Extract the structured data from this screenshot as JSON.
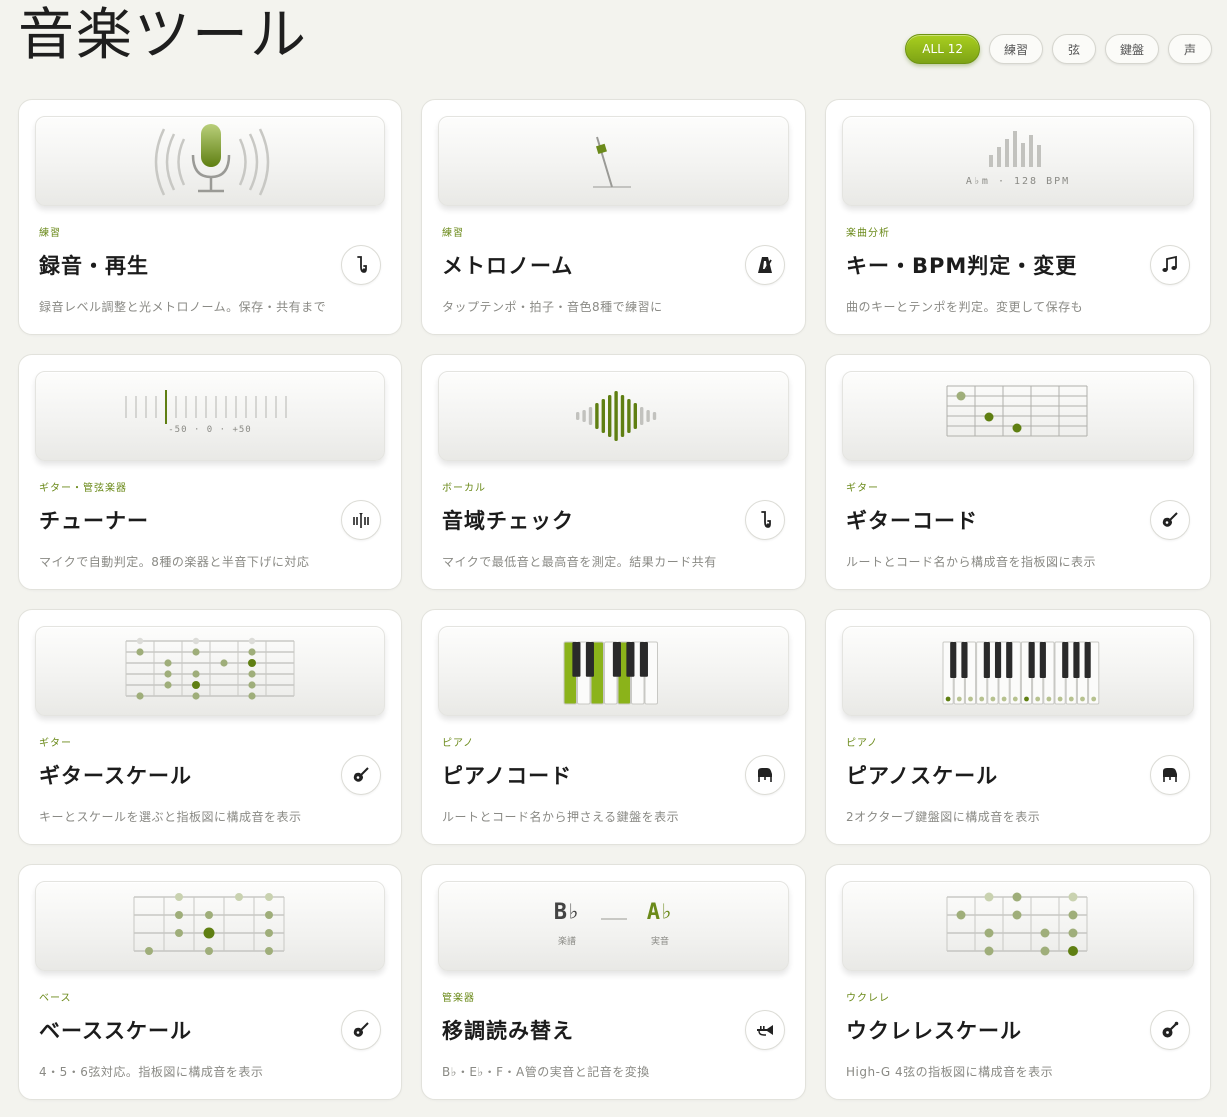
{
  "header": {
    "title": "音楽ツール"
  },
  "filters": [
    {
      "label": "ALL 12",
      "active": true
    },
    {
      "label": "練習",
      "active": false
    },
    {
      "label": "弦",
      "active": false
    },
    {
      "label": "鍵盤",
      "active": false
    },
    {
      "label": "声",
      "active": false
    }
  ],
  "colors": {
    "accent": "#8bb31a",
    "accent_dark": "#5a7a10",
    "category": "#6b8a1a"
  },
  "cards": [
    {
      "category": "練習",
      "title": "録音・再生",
      "desc": "録音レベル調整と光メトロノーム。保存・共有まで",
      "icon": "saxophone-icon"
    },
    {
      "category": "練習",
      "title": "メトロノーム",
      "desc": "タップテンポ・拍子・音色8種で練習に",
      "icon": "metronome-icon"
    },
    {
      "category": "楽曲分析",
      "title": "キー・BPM判定・変更",
      "desc": "曲のキーとテンポを判定。変更して保存も",
      "icon": "music-note-icon",
      "hero_text": "A♭m · 128 BPM"
    },
    {
      "category": "ギター・管弦楽器",
      "title": "チューナー",
      "desc": "マイクで自動判定。8種の楽器と半音下げに対応",
      "icon": "tuner-icon",
      "hero_text": "-50 · 0 · +50"
    },
    {
      "category": "ボーカル",
      "title": "音域チェック",
      "desc": "マイクで最低音と最高音を測定。結果カード共有",
      "icon": "saxophone-icon"
    },
    {
      "category": "ギター",
      "title": "ギターコード",
      "desc": "ルートとコード名から構成音を指板図に表示",
      "icon": "guitar-icon"
    },
    {
      "category": "ギター",
      "title": "ギタースケール",
      "desc": "キーとスケールを選ぶと指板図に構成音を表示",
      "icon": "guitar-icon"
    },
    {
      "category": "ピアノ",
      "title": "ピアノコード",
      "desc": "ルートとコード名から押さえる鍵盤を表示",
      "icon": "piano-icon"
    },
    {
      "category": "ピアノ",
      "title": "ピアノスケール",
      "desc": "2オクターブ鍵盤図に構成音を表示",
      "icon": "piano-icon"
    },
    {
      "category": "ベース",
      "title": "ベーススケール",
      "desc": "4・5・6弦対応。指板図に構成音を表示",
      "icon": "guitar-icon"
    },
    {
      "category": "管楽器",
      "title": "移調読み替え",
      "desc": "B♭・E♭・F・A管の実音と記音を変換",
      "icon": "trumpet-icon",
      "hero_left": "B♭",
      "hero_right": "A♭",
      "hero_left_label": "楽譜",
      "hero_right_label": "実音"
    },
    {
      "category": "ウクレレ",
      "title": "ウクレレスケール",
      "desc": "High-G 4弦の指板図に構成音を表示",
      "icon": "ukulele-icon"
    }
  ]
}
